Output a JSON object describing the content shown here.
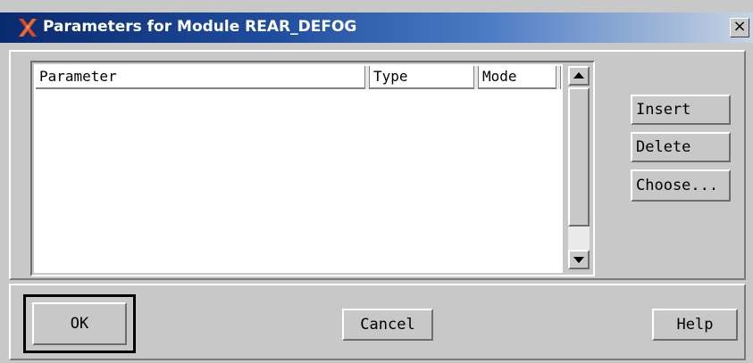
{
  "window": {
    "title": "Parameters for Module REAR_DEFOG",
    "app_icon": "x-icon",
    "close_label": "×"
  },
  "list": {
    "columns": [
      {
        "label": "Parameter"
      },
      {
        "label": "Type"
      },
      {
        "label": "Mode"
      }
    ],
    "rows": []
  },
  "side_buttons": {
    "insert": "Insert",
    "delete": "Delete",
    "choose": "Choose..."
  },
  "footer_buttons": {
    "ok": "OK",
    "cancel": "Cancel",
    "help": "Help"
  },
  "colors": {
    "title_bar_start": "#0a2a6e",
    "title_bar_end": "#c8d4e4",
    "app_icon": "#d9481e",
    "background": "#c8c8c8"
  }
}
